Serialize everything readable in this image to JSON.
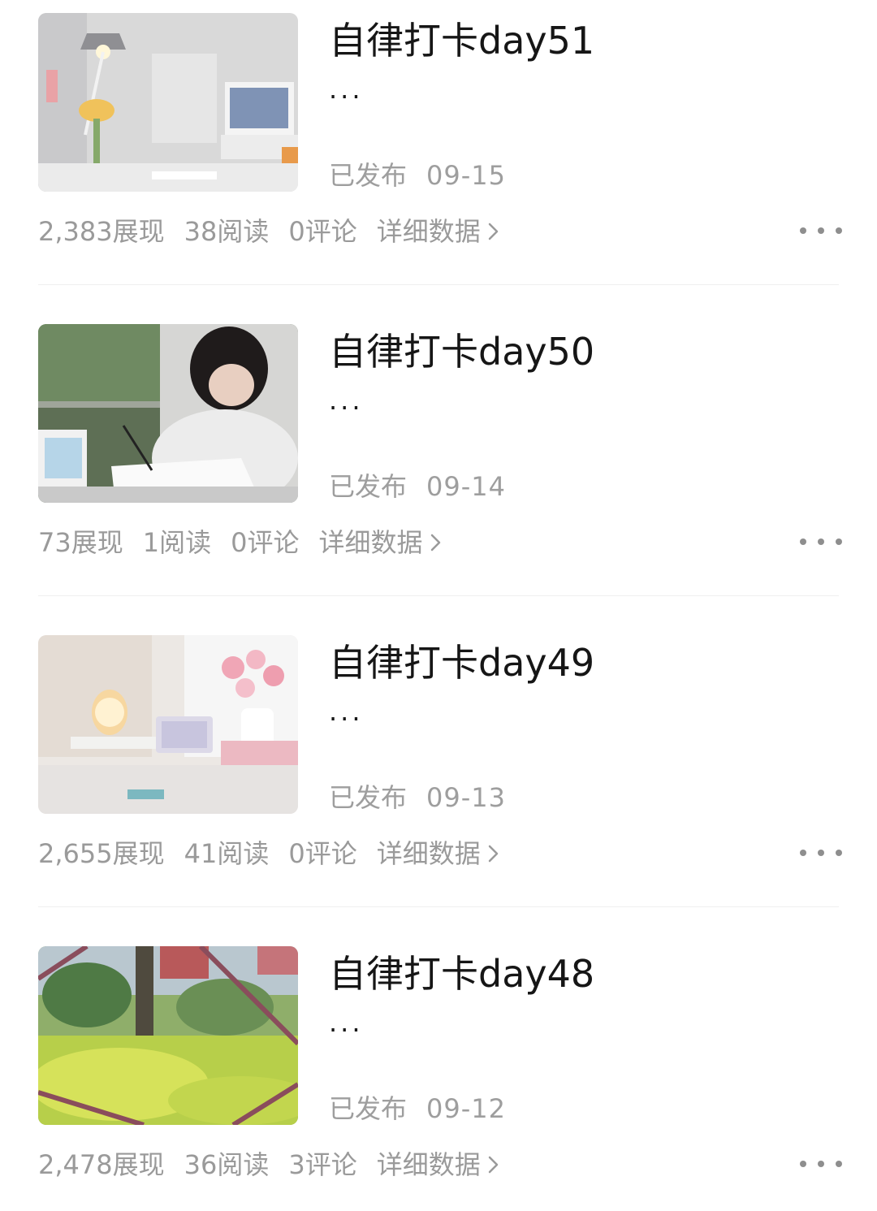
{
  "posts": [
    {
      "title": "自律打卡day51",
      "title_ellipsis": "...",
      "status": "已发布",
      "date": "09-15",
      "impressions": "2,383展现",
      "reads": "38阅读",
      "comments": "0评论",
      "details_label": "详细数据",
      "thumbnail_icon": "desk-lamp-workspace-photo"
    },
    {
      "title": "自律打卡day50",
      "title_ellipsis": "...",
      "status": "已发布",
      "date": "09-14",
      "impressions": "73展现",
      "reads": "1阅读",
      "comments": "0评论",
      "details_label": "详细数据",
      "thumbnail_icon": "studying-person-photo"
    },
    {
      "title": "自律打卡day49",
      "title_ellipsis": "...",
      "status": "已发布",
      "date": "09-13",
      "impressions": "2,655展现",
      "reads": "41阅读",
      "comments": "0评论",
      "details_label": "详细数据",
      "thumbnail_icon": "flowers-desk-photo"
    },
    {
      "title": "自律打卡day48",
      "title_ellipsis": "...",
      "status": "已发布",
      "date": "09-12",
      "impressions": "2,478展现",
      "reads": "36阅读",
      "comments": "3评论",
      "details_label": "详细数据",
      "thumbnail_icon": "yellow-flower-field-photo"
    }
  ],
  "colors": {
    "title": "#161616",
    "meta": "#9e9e9e",
    "stats": "#9a9a9a",
    "divider": "#efefef"
  }
}
